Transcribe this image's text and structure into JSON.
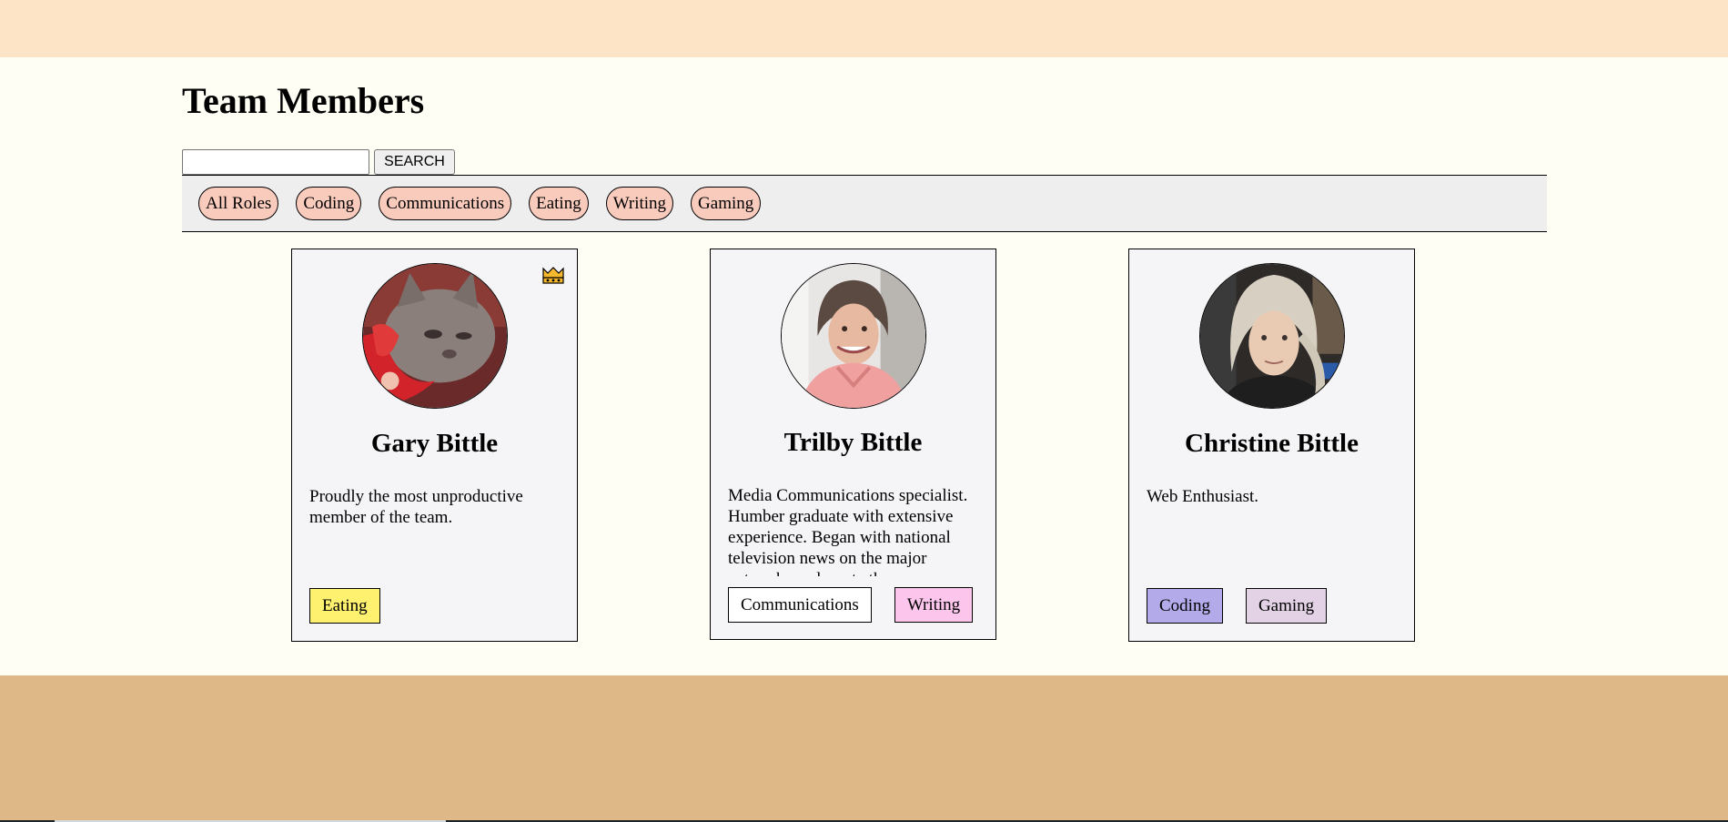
{
  "page": {
    "title": "Team Members"
  },
  "search": {
    "placeholder": "",
    "value": "",
    "button_label": "SEARCH"
  },
  "filters": [
    "All Roles",
    "Coding",
    "Communications",
    "Eating",
    "Writing",
    "Gaming"
  ],
  "members": [
    {
      "name": "Gary Bittle",
      "bio": "Proudly the most unproductive member of the team.",
      "badge_icon": "crown-icon",
      "avatar": "cat-photo",
      "tags": [
        {
          "label": "Eating",
          "color": "#fdf16f"
        }
      ]
    },
    {
      "name": "Trilby Bittle",
      "bio": "Media Communications specialist. Humber graduate with extensive experience. Began with national television news on the major networks and wrote the",
      "avatar": "woman-pink-sweater-photo",
      "tags": [
        {
          "label": "Communications",
          "color": "#ffffff"
        },
        {
          "label": "Writing",
          "color": "#fcc6ec"
        }
      ]
    },
    {
      "name": "Christine Bittle",
      "bio": "Web Enthusiast.",
      "avatar": "woman-blonde-photo",
      "tags": [
        {
          "label": "Coding",
          "color": "#b3abe9"
        },
        {
          "label": "Gaming",
          "color": "#e3d2e6"
        }
      ]
    }
  ],
  "colors": {
    "header_band": "#fee4c6",
    "footer_band": "#dfb887",
    "page_background": "#fffef5",
    "filter_bar": "#eeeeef",
    "filter_pill": "#f9cbbc",
    "card": "#f5f5f7",
    "crown": "#f5b82e"
  }
}
